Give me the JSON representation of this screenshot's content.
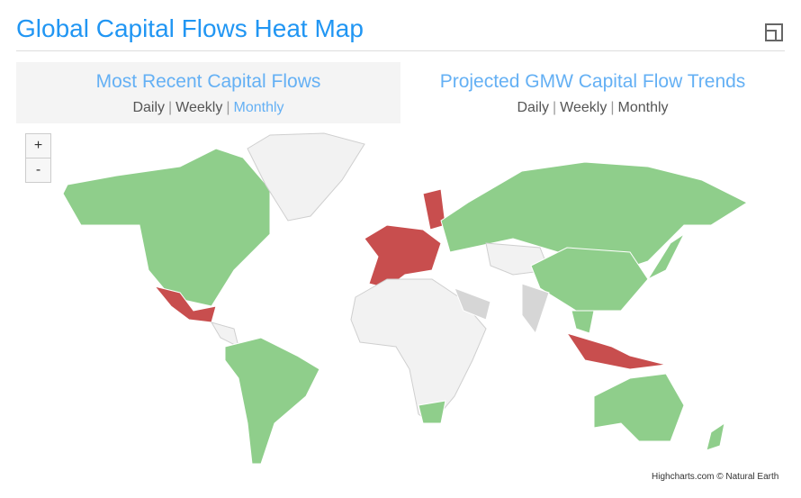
{
  "header": {
    "title": "Global Capital Flows Heat Map",
    "expand_icon": "expand-icon"
  },
  "panels": [
    {
      "title": "Most Recent Capital Flows",
      "links": [
        "Daily",
        "Weekly",
        "Monthly"
      ],
      "selected": "Monthly",
      "active": true
    },
    {
      "title": "Projected GMW Capital Flow Trends",
      "links": [
        "Daily",
        "Weekly",
        "Monthly"
      ],
      "active": false
    }
  ],
  "map": {
    "zoom_in": "+",
    "zoom_out": "-",
    "colors": {
      "positive": "#8fce8b",
      "negative": "#c84e4e",
      "no_data": "#f2f2f2",
      "neutral": "#d6d6d6",
      "border": "#ffffff"
    },
    "credit": "Highcharts.com © Natural Earth"
  }
}
